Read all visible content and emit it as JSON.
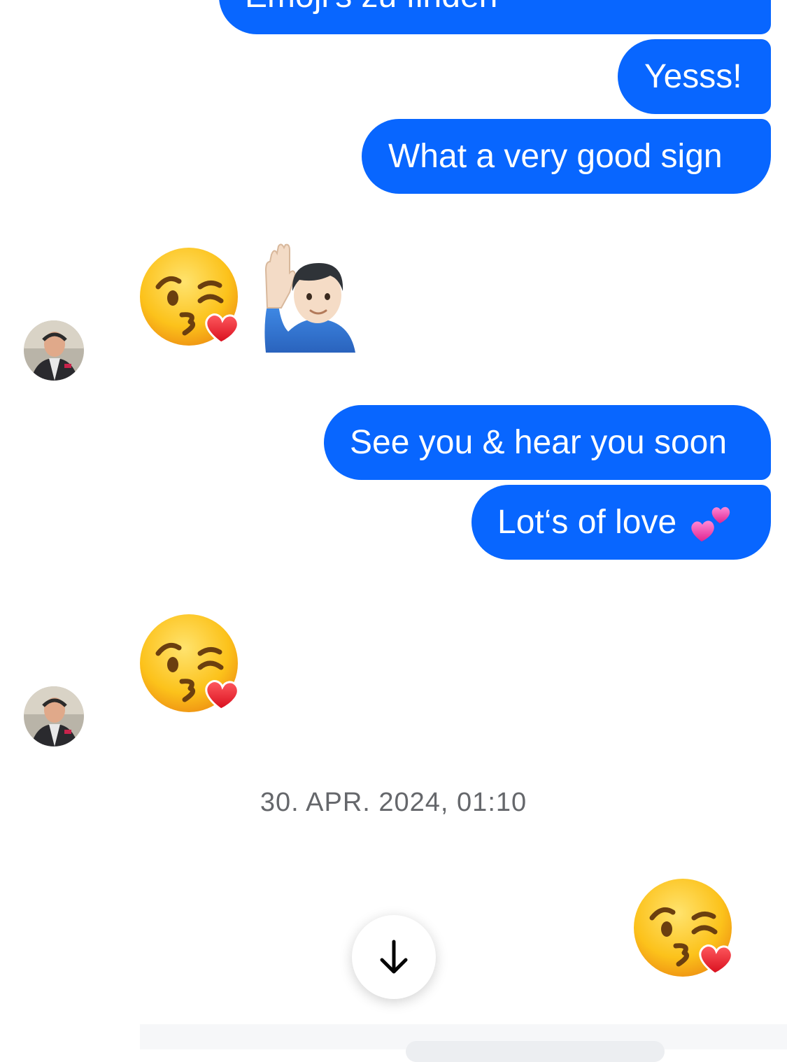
{
  "thread": {
    "messages_top": [
      {
        "text": "Emoji's zu finden"
      },
      {
        "text": "Yesss!"
      },
      {
        "text": "What a very good sign"
      }
    ],
    "incoming_reaction_1": {
      "emojis": [
        "kissing-heart",
        "person-raising-hand"
      ]
    },
    "messages_mid": [
      {
        "text": "See you & hear you soon"
      },
      {
        "text": "Lot‘s of love"
      }
    ],
    "incoming_reaction_2": {
      "emojis": [
        "kissing-heart"
      ]
    },
    "timestamp": "30. APR. 2024, 01:10",
    "outgoing_emoji": "kissing-heart"
  },
  "colors": {
    "outgoing_bubble": "#0866ff",
    "timestamp_text": "#65676b"
  },
  "icons": {
    "scroll_down": "arrow-down-icon",
    "two_hearts": "two-hearts-icon"
  }
}
